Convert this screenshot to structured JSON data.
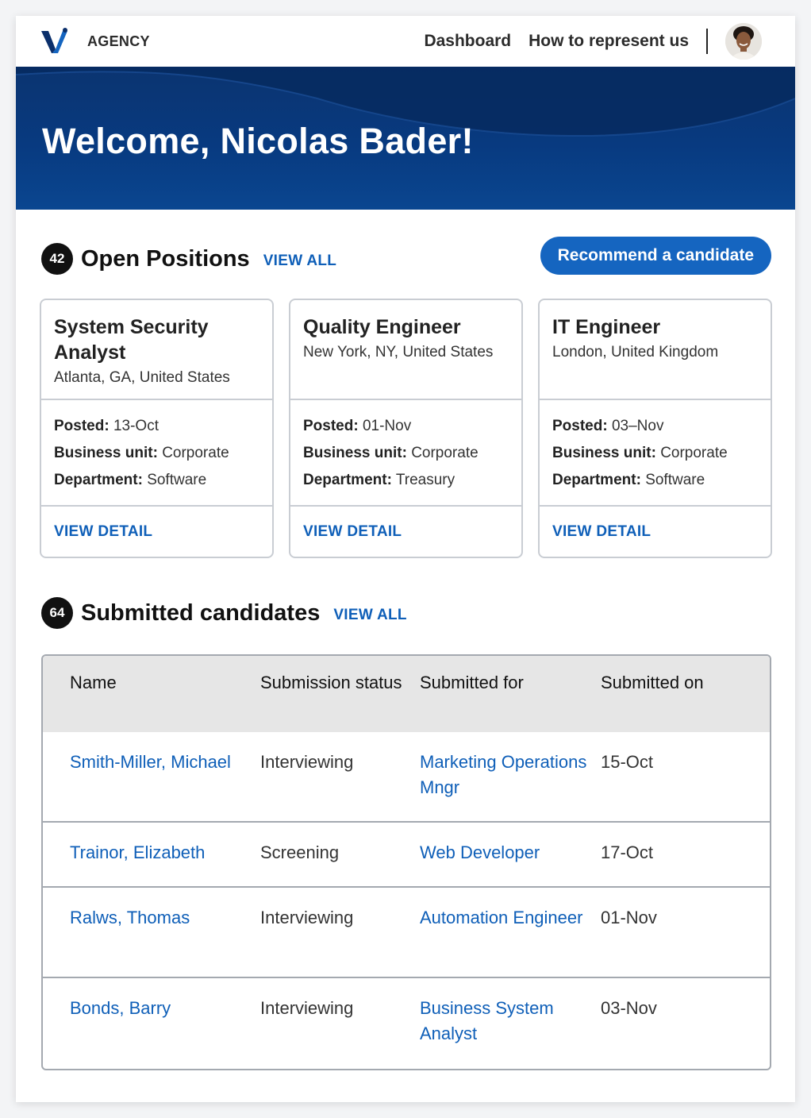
{
  "header": {
    "brand": "AGENCY",
    "nav": [
      "Dashboard",
      "How to represent us"
    ]
  },
  "hero": {
    "greeting": "Welcome, Nicolas Bader!"
  },
  "positions": {
    "count": "42",
    "title": "Open Positions",
    "view_all": "VIEW ALL",
    "cta": "Recommend a candidate",
    "labels": {
      "posted": "Posted:",
      "business_unit": "Business unit:",
      "department": "Department:",
      "view_detail": "VIEW DETAIL"
    },
    "cards": [
      {
        "title": "System Security Analyst",
        "location": "Atlanta, GA, United States",
        "posted": "13-Oct",
        "business_unit": "Corporate",
        "department": "Software"
      },
      {
        "title": "Quality Engineer",
        "location": "New York, NY, United States",
        "posted": "01-Nov",
        "business_unit": "Corporate",
        "department": "Treasury"
      },
      {
        "title": "IT Engineer",
        "location": "London, United Kingdom",
        "posted": "03–Nov",
        "business_unit": "Corporate",
        "department": "Software"
      }
    ]
  },
  "candidates": {
    "count": "64",
    "title": "Submitted candidates",
    "view_all": "VIEW ALL",
    "columns": [
      "Name",
      "Submission status",
      "Submitted for",
      "Submitted on"
    ],
    "rows": [
      {
        "name": "Smith-Miller, Michael",
        "status": "Interviewing",
        "for": "Marketing Operations Mngr",
        "on": "15-Oct"
      },
      {
        "name": "Trainor, Elizabeth",
        "status": "Screening",
        "for": "Web Developer",
        "on": "17-Oct"
      },
      {
        "name": "Ralws, Thomas",
        "status": "Interviewing",
        "for": "Automation Engineer",
        "on": "01-Nov"
      },
      {
        "name": "Bonds, Barry",
        "status": "Interviewing",
        "for": "Business System Analyst",
        "on": "03-Nov"
      }
    ]
  },
  "colors": {
    "accent": "#1565c0",
    "link": "#0f5fb8",
    "hero": "#0b3470"
  },
  "icons": [
    "logo-icon",
    "avatar"
  ]
}
